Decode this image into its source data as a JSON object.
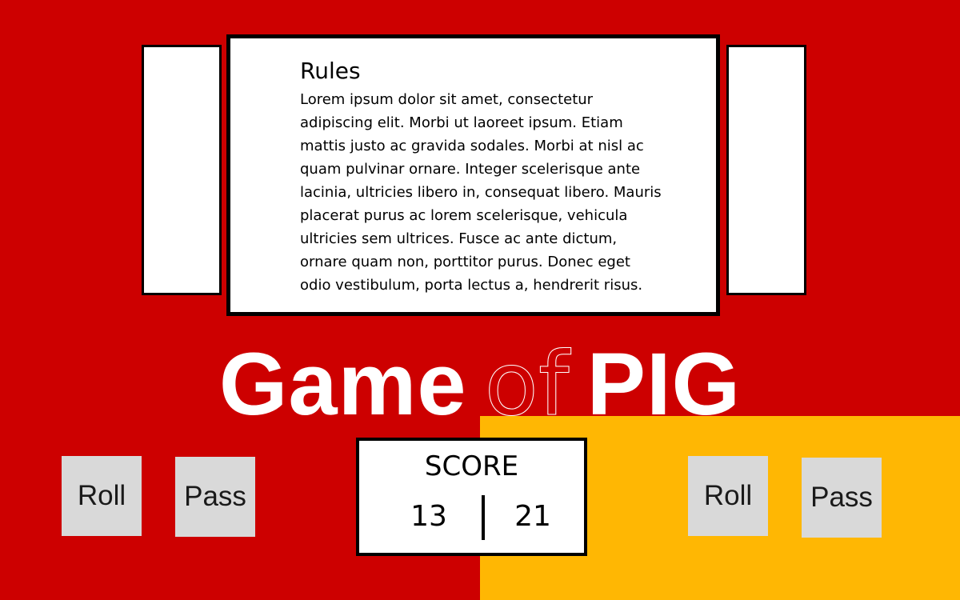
{
  "colors": {
    "player1_background": "#cd0000",
    "player2_background": "#ffb703",
    "button_background": "#d9d9d9",
    "card_background": "#ffffff",
    "border": "#000000"
  },
  "rules": {
    "title": "Rules",
    "body": "Lorem ipsum dolor sit amet, consectetur adipiscing elit. Morbi ut laoreet ipsum. Etiam mattis justo ac gravida sodales. Morbi at nisl ac quam pulvinar ornare. Integer scelerisque ante lacinia, ultricies libero in, consequat libero. Mauris placerat purus ac lorem scelerisque, vehicula ultricies sem ultrices. Fusce ac ante dictum, ornare quam non, porttitor purus. Donec eget odio vestibulum, porta lectus a, hendrerit risus."
  },
  "title": {
    "part1": "Game",
    "part2": "of",
    "part3": "PIG"
  },
  "player1": {
    "roll_label": "Roll",
    "pass_label": "Pass"
  },
  "player2": {
    "roll_label": "Roll",
    "pass_label": "Pass"
  },
  "score": {
    "label": "SCORE",
    "player1": "13",
    "player2": "21"
  }
}
